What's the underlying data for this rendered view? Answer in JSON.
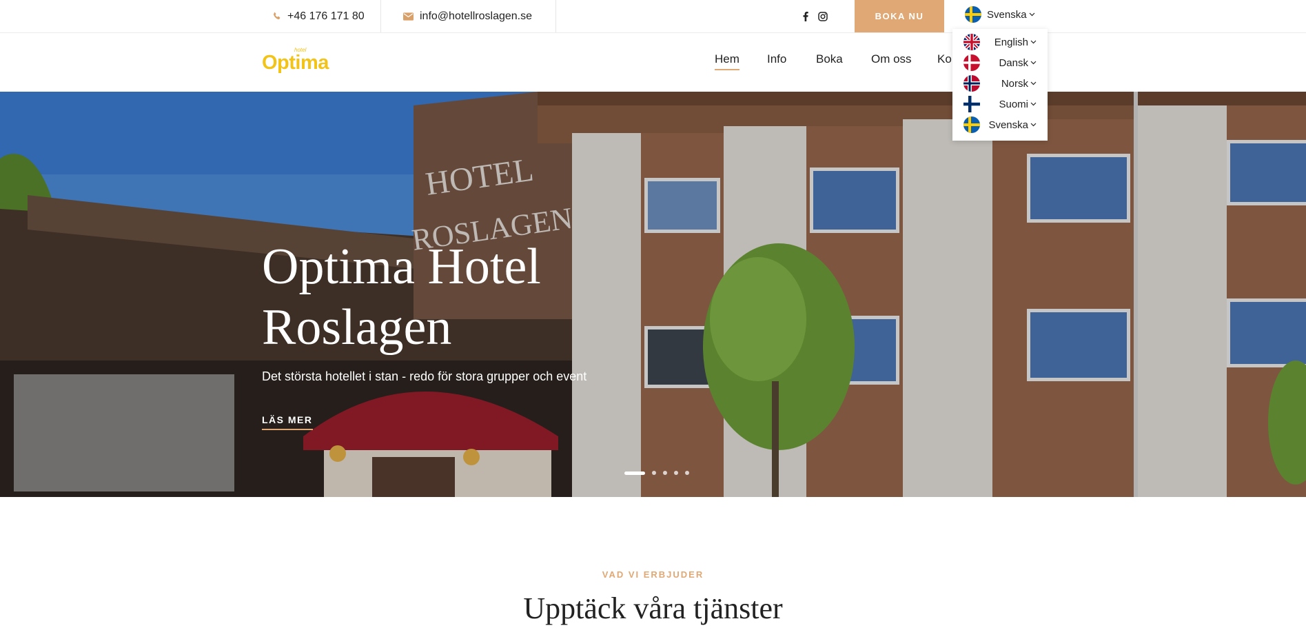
{
  "topbar": {
    "phone": "+46 176 171 80",
    "email": "info@hotellroslagen.se",
    "social": [
      "facebook-icon",
      "instagram-icon"
    ],
    "book_label": "BOKA NU",
    "current_language": "Svenska"
  },
  "language_menu": [
    {
      "label": "English",
      "flag": "uk"
    },
    {
      "label": "Dansk",
      "flag": "dk"
    },
    {
      "label": "Norsk",
      "flag": "no"
    },
    {
      "label": "Suomi",
      "flag": "fi"
    },
    {
      "label": "Svenska",
      "flag": "se"
    }
  ],
  "logo": {
    "text": "Optima",
    "sub": "hotel"
  },
  "nav": [
    {
      "label": "Hem",
      "active": true
    },
    {
      "label": "Info",
      "active": false
    },
    {
      "label": "Boka",
      "active": false
    },
    {
      "label": "Om oss",
      "active": false
    },
    {
      "label": "Ko",
      "active": false
    }
  ],
  "hero": {
    "title_line1": "Optima Hotel",
    "title_line2": "Roslagen",
    "subtitle": "Det största hotellet i stan - redo för stora grupper och event",
    "button": "LÄS MER",
    "slide_count": 5,
    "active_slide": 1
  },
  "services": {
    "eyebrow": "VAD VI ERBJUDER",
    "title": "Upptäck våra tjänster"
  },
  "colors": {
    "accent": "#e0a874",
    "logo": "#f2c318",
    "text": "#222222"
  }
}
